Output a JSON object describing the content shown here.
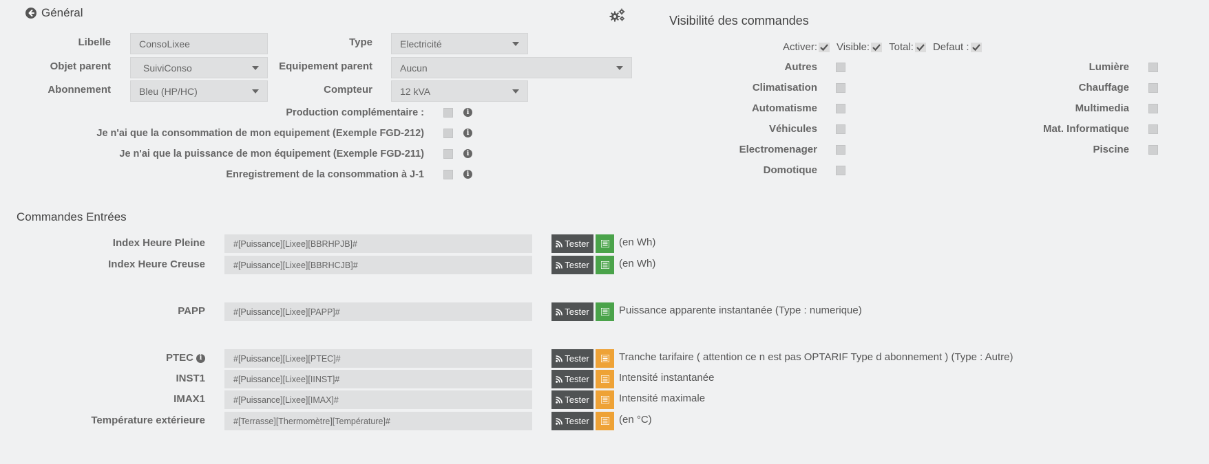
{
  "general": {
    "title": "Général",
    "fields": [
      {
        "label": "Libelle",
        "value": "ConsoLixee"
      },
      {
        "label": "Objet parent",
        "value": "SuiviConso"
      },
      {
        "label": "Abonnement",
        "value": "Bleu (HP/HC)"
      },
      {
        "label": "Type",
        "value": "Electricité"
      },
      {
        "label": "Equipement parent",
        "value": "Aucun"
      },
      {
        "label": "Compteur",
        "value": "12 kVA"
      }
    ],
    "options": [
      {
        "label": "Production complémentaire :"
      },
      {
        "label": "Je n'ai que la consommation de mon equipement (Exemple FGD-212)"
      },
      {
        "label": "Je n'ai que la puissance de mon équipement (Exemple FGD-211)"
      },
      {
        "label": "Enregistrement de la consommation à J-1"
      }
    ]
  },
  "visibility": {
    "title": "Visibilité des commandes",
    "toggles": [
      {
        "label": "Activer:"
      },
      {
        "label": "Visible:"
      },
      {
        "label": "Total:"
      },
      {
        "label": "Defaut :"
      }
    ],
    "left": [
      "Autres",
      "Climatisation",
      "Automatisme",
      "Véhicules",
      "Electromenager",
      "Domotique"
    ],
    "right": [
      "Lumière",
      "Chauffage",
      "Multimedia",
      "Mat. Informatique",
      "Piscine"
    ]
  },
  "commands": {
    "title": "Commandes Entrées",
    "test_label": "Tester",
    "rows": [
      {
        "label": "Index Heure Pleine",
        "value": "#[Puissance][Lixee][BBRHPJB]#",
        "desc": "(en Wh)",
        "hist_color": "#4aa34a"
      },
      {
        "label": "Index Heure Creuse",
        "value": "#[Puissance][Lixee][BBRHCJB]#",
        "desc": "(en Wh)",
        "hist_color": "#4aa34a"
      },
      {
        "label": "PAPP",
        "value": "#[Puissance][Lixee][PAPP]#",
        "desc": "Puissance apparente instantanée (Type : numerique)",
        "hist_color": "#4aa34a"
      },
      {
        "label": "PTEC",
        "value": "#[Puissance][Lixee][PTEC]#",
        "desc": "Tranche tarifaire ( attention ce n est pas OPTARIF Type d abonnement ) (Type : Autre)",
        "hist_color": "#eea236"
      },
      {
        "label": "INST1",
        "value": "#[Puissance][Lixee][IINST]#",
        "desc": "Intensité instantanée",
        "hist_color": "#eea236"
      },
      {
        "label": "IMAX1",
        "value": "#[Puissance][Lixee][IMAX]#",
        "desc": "Intensité maximale",
        "hist_color": "#eea236"
      },
      {
        "label": "Température extérieure",
        "value": "#[Terrasse][Thermomètre][Température]#",
        "desc": "(en °C)",
        "hist_color": "#eea236"
      }
    ]
  }
}
